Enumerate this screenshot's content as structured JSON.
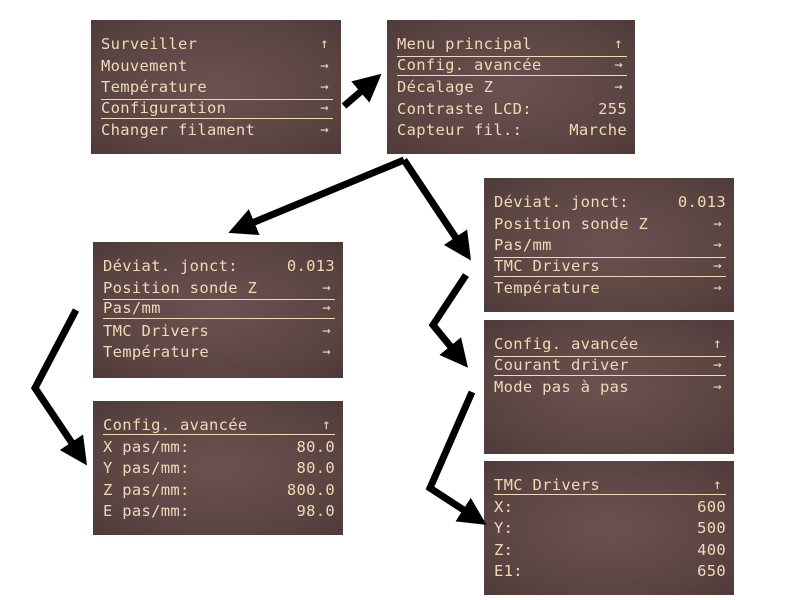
{
  "screens": [
    {
      "id": "main_menu",
      "rows": [
        {
          "label": "Surveiller",
          "icon": "up-arrow-icon",
          "glyph": "↑"
        },
        {
          "label": "Mouvement",
          "icon": "right-arrow-icon",
          "glyph": "→"
        },
        {
          "label": "Température",
          "icon": "right-arrow-icon",
          "glyph": "→"
        },
        {
          "label": "Configuration",
          "icon": "right-arrow-icon",
          "glyph": "→",
          "selected": true
        },
        {
          "label": "Changer filament",
          "icon": "right-arrow-icon",
          "glyph": "→"
        }
      ]
    },
    {
      "id": "configuration",
      "rows": [
        {
          "label": "Menu principal",
          "icon": "up-arrow-icon",
          "glyph": "↑"
        },
        {
          "label": "Config. avancée",
          "icon": "right-arrow-icon",
          "glyph": "→",
          "selected": true
        },
        {
          "label": "Décalage Z",
          "icon": "right-arrow-icon",
          "glyph": "→"
        },
        {
          "label": "Contraste LCD:",
          "value": "255"
        },
        {
          "label": "Capteur fil.:",
          "value": "Marche"
        }
      ]
    },
    {
      "id": "advanced_a",
      "rows": [
        {
          "label": "Déviat. jonct:",
          "value": "0.013"
        },
        {
          "label": "Position sonde Z",
          "icon": "right-arrow-icon",
          "glyph": "→"
        },
        {
          "label": "Pas/mm",
          "icon": "right-arrow-icon",
          "glyph": "→",
          "selected": true
        },
        {
          "label": "TMC Drivers",
          "icon": "right-arrow-icon",
          "glyph": "→"
        },
        {
          "label": "Température",
          "icon": "right-arrow-icon",
          "glyph": "→"
        }
      ]
    },
    {
      "id": "steps_per_mm",
      "rows": [
        {
          "label": "Config. avancée",
          "icon": "up-arrow-icon",
          "glyph": "↑",
          "header": true
        },
        {
          "label": "X pas/mm:",
          "value": "80.0"
        },
        {
          "label": "Y pas/mm:",
          "value": "80.0"
        },
        {
          "label": "Z pas/mm:",
          "value": "800.0"
        },
        {
          "label": "E pas/mm:",
          "value": "98.0"
        }
      ]
    },
    {
      "id": "advanced_b",
      "rows": [
        {
          "label": "Déviat. jonct:",
          "value": "0.013"
        },
        {
          "label": "Position sonde Z",
          "icon": "right-arrow-icon",
          "glyph": "→"
        },
        {
          "label": "Pas/mm",
          "icon": "right-arrow-icon",
          "glyph": "→"
        },
        {
          "label": "TMC Drivers",
          "icon": "right-arrow-icon",
          "glyph": "→",
          "selected": true
        },
        {
          "label": "Température",
          "icon": "right-arrow-icon",
          "glyph": "→"
        }
      ]
    },
    {
      "id": "tmc_drivers_menu",
      "rows": [
        {
          "label": "Config. avancée",
          "icon": "up-arrow-icon",
          "glyph": "↑"
        },
        {
          "label": "Courant driver",
          "icon": "right-arrow-icon",
          "glyph": "→",
          "selected": true
        },
        {
          "label": "Mode pas à pas",
          "icon": "right-arrow-icon",
          "glyph": "→"
        }
      ]
    },
    {
      "id": "driver_current",
      "rows": [
        {
          "label": "TMC Drivers",
          "icon": "up-arrow-icon",
          "glyph": "↑",
          "header": true
        },
        {
          "label": "X:",
          "value": "600"
        },
        {
          "label": "Y:",
          "value": "500"
        },
        {
          "label": "Z:",
          "value": "400"
        },
        {
          "label": "E1:",
          "value": "650"
        }
      ]
    }
  ],
  "colors": {
    "lcd_bg": "#5a4644",
    "lcd_text": "#f1d9b8",
    "arrow": "#000000"
  }
}
